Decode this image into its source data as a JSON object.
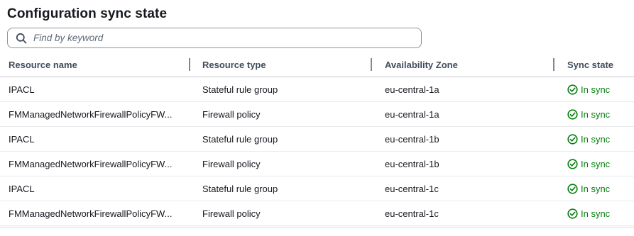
{
  "title": "Configuration sync state",
  "search": {
    "placeholder": "Find by keyword",
    "value": ""
  },
  "columns": [
    "Resource name",
    "Resource type",
    "Availability Zone",
    "Sync state"
  ],
  "rows": [
    {
      "name": "IPACL",
      "type": "Stateful rule group",
      "zone": "eu-central-1a",
      "sync": "In sync"
    },
    {
      "name": "FMManagedNetworkFirewallPolicyFW...",
      "type": "Firewall policy",
      "zone": "eu-central-1a",
      "sync": "In sync"
    },
    {
      "name": "IPACL",
      "type": "Stateful rule group",
      "zone": "eu-central-1b",
      "sync": "In sync"
    },
    {
      "name": "FMManagedNetworkFirewallPolicyFW...",
      "type": "Firewall policy",
      "zone": "eu-central-1b",
      "sync": "In sync"
    },
    {
      "name": "IPACL",
      "type": "Stateful rule group",
      "zone": "eu-central-1c",
      "sync": "In sync"
    },
    {
      "name": "FMManagedNetworkFirewallPolicyFW...",
      "type": "Firewall policy",
      "zone": "eu-central-1c",
      "sync": "In sync"
    }
  ],
  "icons": {
    "search": "search-icon",
    "status": "check-circle-icon"
  },
  "colors": {
    "success": "#037f0c",
    "text": "#16191f",
    "header_text": "#414d5c"
  }
}
